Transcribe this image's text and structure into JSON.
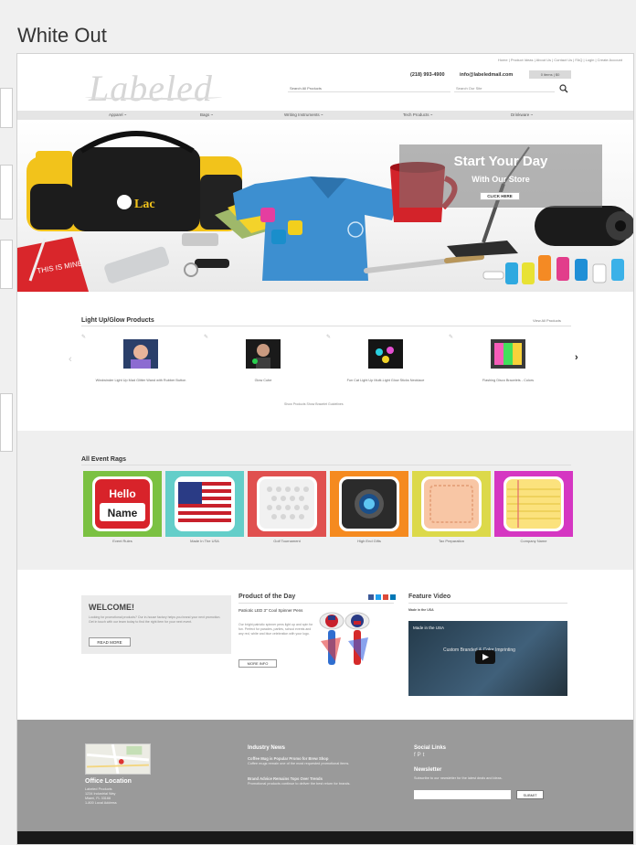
{
  "window": {
    "title": "White Out"
  },
  "header": {
    "top_links": "Home | Product Ideas | About Us | Contact Us | FAQ | Login | Create Account",
    "logo": "Labeled",
    "phone": "(218) 993-4900",
    "email": "info@labeledmail.com",
    "account_button": "0 items | $0",
    "category_select": "Search All Products",
    "search_placeholder": "Search Our Site"
  },
  "nav": [
    {
      "label": "Apparel ~"
    },
    {
      "label": "Bags ~"
    },
    {
      "label": "Writing Instruments ~"
    },
    {
      "label": "Tech Products ~"
    },
    {
      "label": "Drinkware ~"
    }
  ],
  "hero": {
    "headline": "Start Your Day",
    "subheadline": "With Our Store",
    "button": "CLICK HERE",
    "bag_logo": "Lac",
    "notebook_text": "THIS IS MINE"
  },
  "section_glow": {
    "title": "Light Up/Glow Products",
    "view_all": "View All Products",
    "products": [
      {
        "name": "Windwinder Light Up Mad Glitter Wand with Rubber Button"
      },
      {
        "name": "Glow Cube"
      },
      {
        "name": "Fun Cat Light Up Multi-Light Glow Sticks Necklace"
      },
      {
        "name": "Flashing Disco Bracelets - Colors"
      }
    ],
    "pager": "Show Products  Show Bracelet Guidelines"
  },
  "section_event": {
    "title": "All Event Rags",
    "tiles": [
      {
        "label": "Event Rules",
        "bg": "#7bc142",
        "line1": "Hello",
        "line2": "Name"
      },
      {
        "label": "Made In The USA",
        "bg": "#64cec9"
      },
      {
        "label": "Golf Tournament",
        "bg": "#e0504f"
      },
      {
        "label": "High End Gifts",
        "bg": "#f58a1f"
      },
      {
        "label": "Tax Preparation",
        "bg": "#dcd94a"
      },
      {
        "label": "Company Name",
        "bg": "#d536c2"
      }
    ]
  },
  "section_info": {
    "welcome_title": "WELCOME!",
    "welcome_text": "Looking for promotional products? Our in-house factory helps you brand your next promotion. Get in touch with our team today to find the right item for your next event.",
    "read_more": "READ MORE",
    "pod_title": "Product of the Day",
    "pod_product": "Patriotic LED 3\" Cool Spinner Pens",
    "pod_text": "Our bright patriotic spinner pens light up and spin for fun. Perfect for parades, parties, school events and any red, white and blue celebration with your logo.",
    "pod_button": "MORE INFO",
    "video_title": "Feature Video",
    "video_subtitle": "Made in the USA",
    "video_caption": "Made in the USA",
    "video_overlay": "Custom Branded & Color Imprinting"
  },
  "footer": {
    "office_title": "Office Location",
    "office_text": "Labeled Products\n1234 Industrial Way\nMiami, FL 33166\n1-800 Local Address",
    "news_title": "Industry News",
    "news_items": [
      {
        "title": "Coffee Mug is Popular Promo for Brew Shop",
        "text": "Coffee mugs remain one of the most requested promotional items."
      },
      {
        "title": "Brand Advice Remains Tops Over Trends",
        "text": "Promotional products continue to deliver the best return for brands."
      }
    ],
    "social_title": "Social Links",
    "newsletter_title": "Newsletter",
    "newsletter_text": "Subscribe to our newsletter for the latest deals and ideas.",
    "submit": "SUBMIT"
  }
}
